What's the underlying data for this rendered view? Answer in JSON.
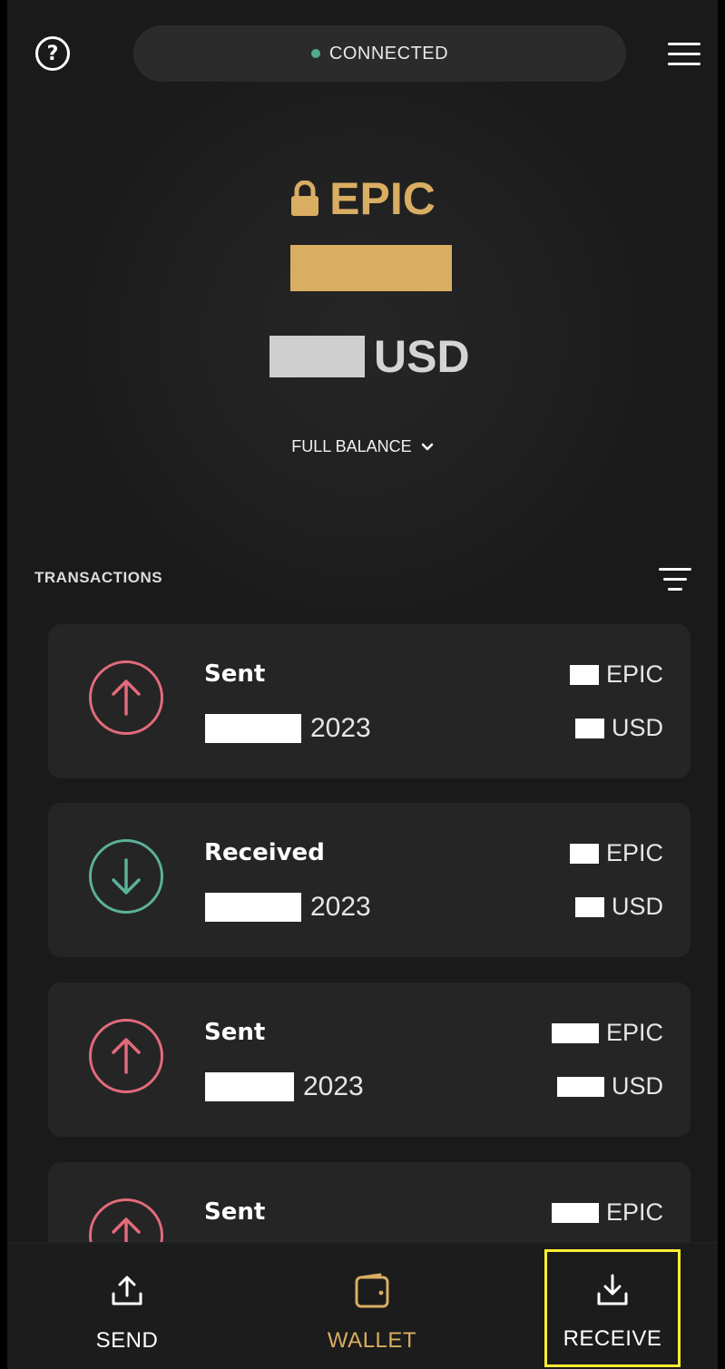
{
  "status": {
    "text": "CONNECTED",
    "dot_color": "#4fae8c"
  },
  "balance": {
    "currency": "EPIC",
    "fiat_currency": "USD",
    "mode_label": "FULL BALANCE",
    "accent_color": "#d9ae62"
  },
  "transactions": {
    "header": "TRANSACTIONS",
    "items": [
      {
        "type": "Sent",
        "year": "2023",
        "unit_crypto": "EPIC",
        "unit_fiat": "USD",
        "direction": "sent"
      },
      {
        "type": "Received",
        "year": "2023",
        "unit_crypto": "EPIC",
        "unit_fiat": "USD",
        "direction": "received"
      },
      {
        "type": "Sent",
        "year": "2023",
        "unit_crypto": "EPIC",
        "unit_fiat": "USD",
        "direction": "sent"
      },
      {
        "type": "Sent",
        "unit_crypto": "EPIC",
        "direction": "sent"
      }
    ]
  },
  "nav": {
    "send_label": "SEND",
    "wallet_label": "WALLET",
    "receive_label": "RECEIVE"
  },
  "icons": {
    "help": "help-circle-icon",
    "menu": "hamburger-menu-icon",
    "lock": "lock-icon",
    "chevron": "chevron-down-icon",
    "filter": "filter-icon",
    "sent": "arrow-up-circle-icon",
    "received": "arrow-down-circle-icon",
    "send": "upload-icon",
    "wallet": "wallet-icon",
    "receive": "download-icon"
  }
}
